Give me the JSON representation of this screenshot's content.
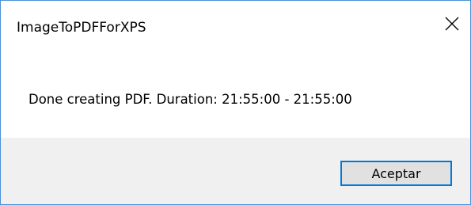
{
  "window": {
    "title": "ImageToPDFForXPS",
    "close_icon": "close-icon"
  },
  "dialog": {
    "message": "Done creating PDF.  Duration:  21:55:00 - 21:55:00"
  },
  "footer": {
    "ok_label": "Aceptar"
  },
  "colors": {
    "border": "#4a90d9",
    "footer_bg": "#f0f0f0",
    "button_bg": "#e1e1e1",
    "button_border": "#0078d7"
  }
}
